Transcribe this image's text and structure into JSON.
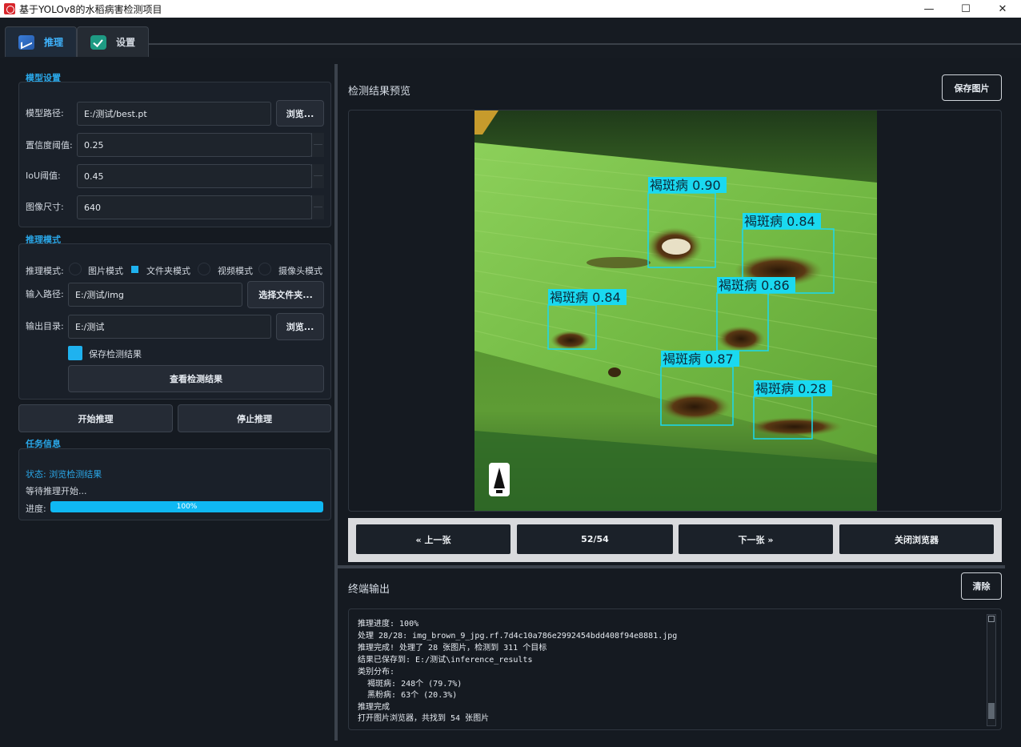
{
  "window": {
    "title": "基于YOLOv8的水稻病害检测项目",
    "controls": {
      "minimize": "—",
      "maximize": "☐",
      "close": "✕"
    }
  },
  "tabs": [
    {
      "label": "推理",
      "icon": "chart-icon",
      "active": true
    },
    {
      "label": "设置",
      "icon": "check-icon",
      "active": false
    }
  ],
  "model_settings": {
    "title": "模型设置",
    "model_path_label": "模型路径:",
    "model_path_value": "E:/测试/best.pt",
    "browse_label": "浏览...",
    "conf_label": "置信度阈值:",
    "conf_value": "0.25",
    "iou_label": "IoU阈值:",
    "iou_value": "0.45",
    "imgsz_label": "图像尺寸:",
    "imgsz_value": "640"
  },
  "inference_mode": {
    "title": "推理模式",
    "mode_label": "推理模式:",
    "options": [
      "图片模式",
      "文件夹模式",
      "视频模式",
      "摄像头模式"
    ],
    "selected": "文件夹模式",
    "input_label": "输入路径:",
    "input_value": "E:/测试/img",
    "select_folder_label": "选择文件夹...",
    "output_label": "输出目录:",
    "output_value": "E:/测试",
    "browse_label": "浏览...",
    "save_results_label": "保存检测结果",
    "save_results_checked": true,
    "view_results_label": "查看检测结果"
  },
  "actions": {
    "start_label": "开始推理",
    "stop_label": "停止推理"
  },
  "task_info": {
    "title": "任务信息",
    "status": "状态: 浏览检测结果",
    "message": "等待推理开始...",
    "progress_label": "进度:",
    "progress_value": 1.0,
    "progress_text": "100%"
  },
  "preview": {
    "title": "检测结果预览",
    "save_image_label": "保存图片",
    "detections": [
      {
        "label": "褐斑病 0.90"
      },
      {
        "label": "褐斑病 0.84"
      },
      {
        "label": "褐斑病 0.84"
      },
      {
        "label": "褐斑病 0.86"
      },
      {
        "label": "褐斑病 0.87"
      },
      {
        "label": "褐斑病 0.28"
      }
    ],
    "box_color": "#1ad9f0"
  },
  "browser": {
    "prev_label": "« 上一张",
    "counter": "52/54",
    "next_label": "下一张 »",
    "close_label": "关闭浏览器"
  },
  "terminal": {
    "title": "终端输出",
    "clear_label": "清除",
    "lines": [
      "推理进度: 100%",
      "处理 28/28: img_brown_9_jpg.rf.7d4c10a786e2992454bdd408f94e8881.jpg",
      "推理完成! 处理了 28 张图片，检测到 311 个目标",
      "结果已保存到: E:/测试\\inference_results",
      "类别分布:",
      "  褐斑病: 248个 (79.7%)",
      "  黑粉病: 63个 (20.3%)",
      "推理完成",
      "打开图片浏览器，共找到 54 张图片"
    ]
  },
  "colors": {
    "accent": "#1fb2ef",
    "background": "#151a21",
    "section_title": "#2aa7e8"
  }
}
